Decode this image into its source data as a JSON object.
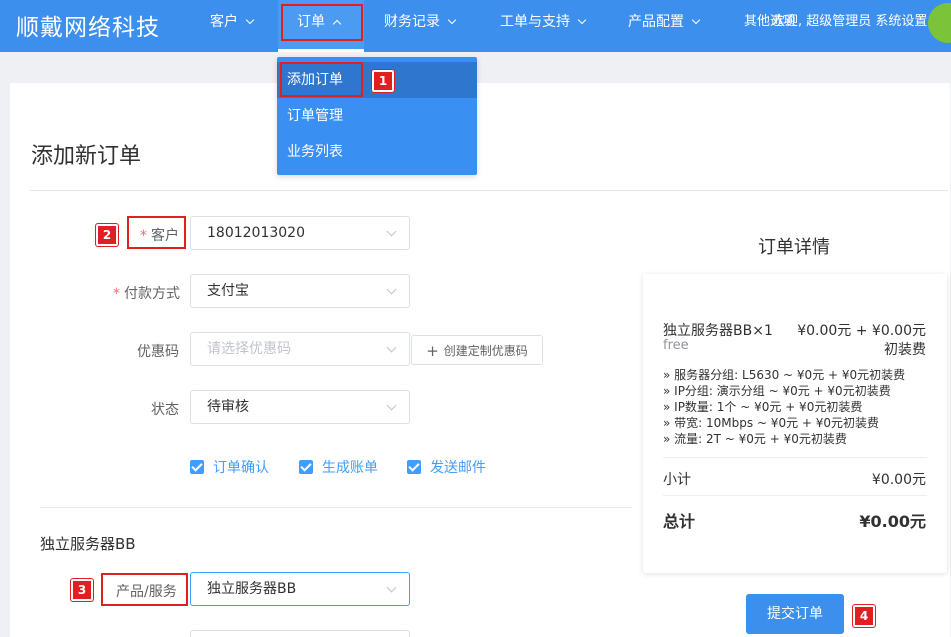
{
  "nav": {
    "brand": "顺戴网络科技",
    "items": [
      {
        "label": "客户"
      },
      {
        "label": "订单"
      },
      {
        "label": "财务记录"
      },
      {
        "label": "工单与支持"
      },
      {
        "label": "产品配置"
      }
    ],
    "overlap_text_a": "其他选项",
    "overlap_text_b": "欢迎, 超级管理员 系统设置"
  },
  "dropdown": {
    "items": [
      {
        "label": "添加订单"
      },
      {
        "label": "订单管理"
      },
      {
        "label": "业务列表"
      }
    ]
  },
  "page": {
    "title": "添加新订单"
  },
  "form": {
    "customer": {
      "label": "客户",
      "value": "18012013020"
    },
    "payment": {
      "label": "付款方式",
      "value": "支付宝"
    },
    "coupon": {
      "label": "优惠码",
      "placeholder": "请选择优惠码",
      "button": "创建定制优惠码"
    },
    "status": {
      "label": "状态",
      "value": "待审核"
    },
    "checkboxes": [
      {
        "label": "订单确认",
        "checked": true
      },
      {
        "label": "生成账单",
        "checked": true
      },
      {
        "label": "发送邮件",
        "checked": true
      }
    ],
    "section_title": "独立服务器BB",
    "product": {
      "label": "产品/服务",
      "value": "独立服务器BB"
    }
  },
  "summary": {
    "title": "订单详情",
    "item_name": "独立服务器BB×1",
    "item_price": "¥0.00元 + ¥0.00元",
    "item_price_suffix": "初装费",
    "item_cycle": "free",
    "config_lines": [
      "» 服务器分组: L5630 ~ ¥0元 + ¥0元初装费",
      "» IP分组: 演示分组 ~ ¥0元 + ¥0元初装费",
      "» IP数量: 1个 ~ ¥0元 + ¥0元初装费",
      "» 带宽: 10Mbps ~ ¥0元 + ¥0元初装费",
      "» 流量: 2T ~ ¥0元 + ¥0元初装费"
    ],
    "subtotal_label": "小计",
    "subtotal_value": "¥0.00元",
    "total_label": "总计",
    "total_value": "¥0.00元",
    "submit": "提交订单"
  },
  "annotations": [
    "1",
    "2",
    "3",
    "4"
  ],
  "colors": {
    "nav_bg": "#3d8fee",
    "dropdown_bg": "#3a8ff2",
    "accent": "#409eff",
    "annotation_red": "#e02020",
    "required_star": "#f56c6c"
  }
}
